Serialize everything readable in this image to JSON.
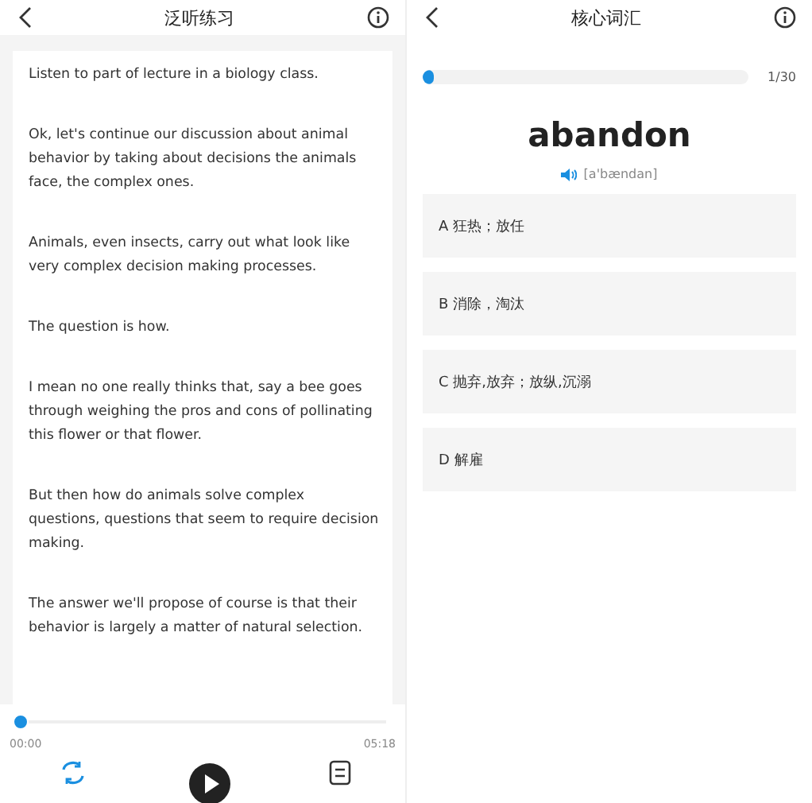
{
  "listening": {
    "title": "泛听练习",
    "paragraphs": [
      "Listen to part of lecture in a biology class.",
      "Ok, let's continue our discussion about animal behavior by taking about decisions the animals face, the complex ones.",
      "Animals, even insects, carry out what look like very complex decision making processes.",
      "The question is how.",
      "I mean no one really thinks that, say a bee goes through weighing the pros and cons of pollinating this flower or that flower.",
      "But then how do animals solve complex questions, questions that seem to require decision making.",
      "The answer we'll propose of course is that their behavior is largely a matter of natural selection."
    ],
    "player": {
      "level": 0.0,
      "elapsed": "00:00",
      "total": "05:18",
      "playing": false
    }
  },
  "vocabulary": {
    "title": "核心词汇",
    "progress": {
      "level": 0.034,
      "count": "1/30"
    },
    "word": "abandon",
    "phonetic": "[a'bændan]",
    "options": [
      {
        "label": "A 狂热；放任",
        "selected": false
      },
      {
        "label": "B 消除，淘汰",
        "selected": false
      },
      {
        "label": "C 抛弃,放弃；放纵,沉溺",
        "selected": false
      },
      {
        "label": "D 解雇",
        "selected": false
      }
    ]
  }
}
